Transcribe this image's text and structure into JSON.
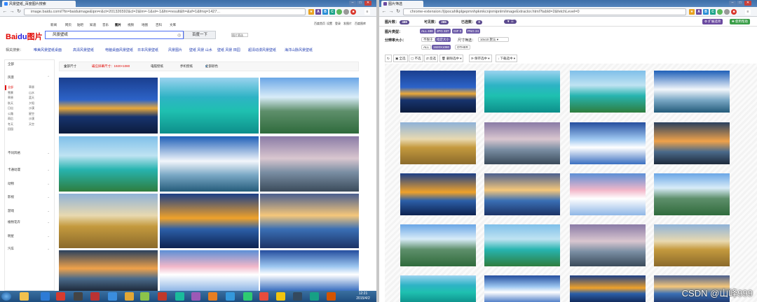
{
  "left": {
    "tab_title": "风景壁纸_百度图片搜索",
    "address": "image.baidu.com/i?tn=baiduimage&ipn=r&ct=201326592&cl=2&lm=-1&st=-1&fm=result&fr=&sf=1&fmq=1427...",
    "top_links": [
      "新闻",
      "网页",
      "贴吧",
      "知道",
      "音乐",
      "图片",
      "视频",
      "地图",
      "百科",
      "文库"
    ],
    "right_links": [
      "百度首页",
      "设置",
      "登录",
      "发图片",
      "百度图库"
    ],
    "logo_bai": "Bai",
    "logo_du": "du",
    "logo_pic": "图片",
    "search_value": "风景壁纸",
    "search_button": "百度一下",
    "related_label": "相关搜索：",
    "related": [
      "唯美风景壁纸桌面",
      "高清风景壁纸",
      "电脑桌面风景壁纸",
      "日本风景壁纸",
      "风景图片",
      "壁纸 风景 山水",
      "壁纸 风景 田园",
      "超清动漫风景壁纸",
      "海洋山脉风景壁纸"
    ],
    "filter": {
      "full": "全部尺寸",
      "screen": "适应屏幕尺寸：1920×1080",
      "pc": "电脑壁纸",
      "phone": "手机壁纸",
      "color": "全部颜色"
    },
    "side": {
      "all": "全部",
      "scenery": "风景",
      "sub_left": [
        "全部",
        "雪景",
        "草原",
        "秋天",
        "日出",
        "公路",
        "雨后",
        "冬天",
        "田园"
      ],
      "sub_right": [
        "草原",
        "山水",
        "蓝天",
        "夕阳",
        "沙漠",
        "星空",
        "沙漠",
        "天空"
      ],
      "groups": [
        "不同风格",
        "卡通动漫",
        "动物",
        "影视",
        "游戏",
        "植物花卉",
        "明星",
        "汽车"
      ]
    },
    "taskbar": {
      "time": "12:21",
      "date": "2015/4/2"
    }
  },
  "right": {
    "tab_title": "图片筛选",
    "address": "chrome-extension://jipocahlkplgepmnhpkmkcnjnmipnlm/imageExtractor.html?tabId=2&fetchLevel=0",
    "count_label": "图片数：",
    "count": "488",
    "avail_label": "可见数：",
    "avail": "285",
    "selected_label": "已选数：",
    "selected": "0",
    "type_label": "图片类型：",
    "types": [
      "ALL 488",
      "JPG 337",
      "GIF 0",
      "PNG 24"
    ],
    "size_label": "分辨率大小：",
    "size_any": "不限于",
    "size_set": "指定大小",
    "size_filter_label": "尺寸筛选：",
    "size_filter_value": "10x10 默认",
    "all_chip": "ALL",
    "res_chip": "1920X1080",
    "other_chip": "OTHER",
    "tools": [
      "全选",
      "不选",
      "反选",
      "删除选中",
      "保存选中",
      "下载选中"
    ],
    "ext_buttons": [
      "扩展选项",
      "使用帮助"
    ],
    "watermark": "CSDN @山峰999"
  }
}
